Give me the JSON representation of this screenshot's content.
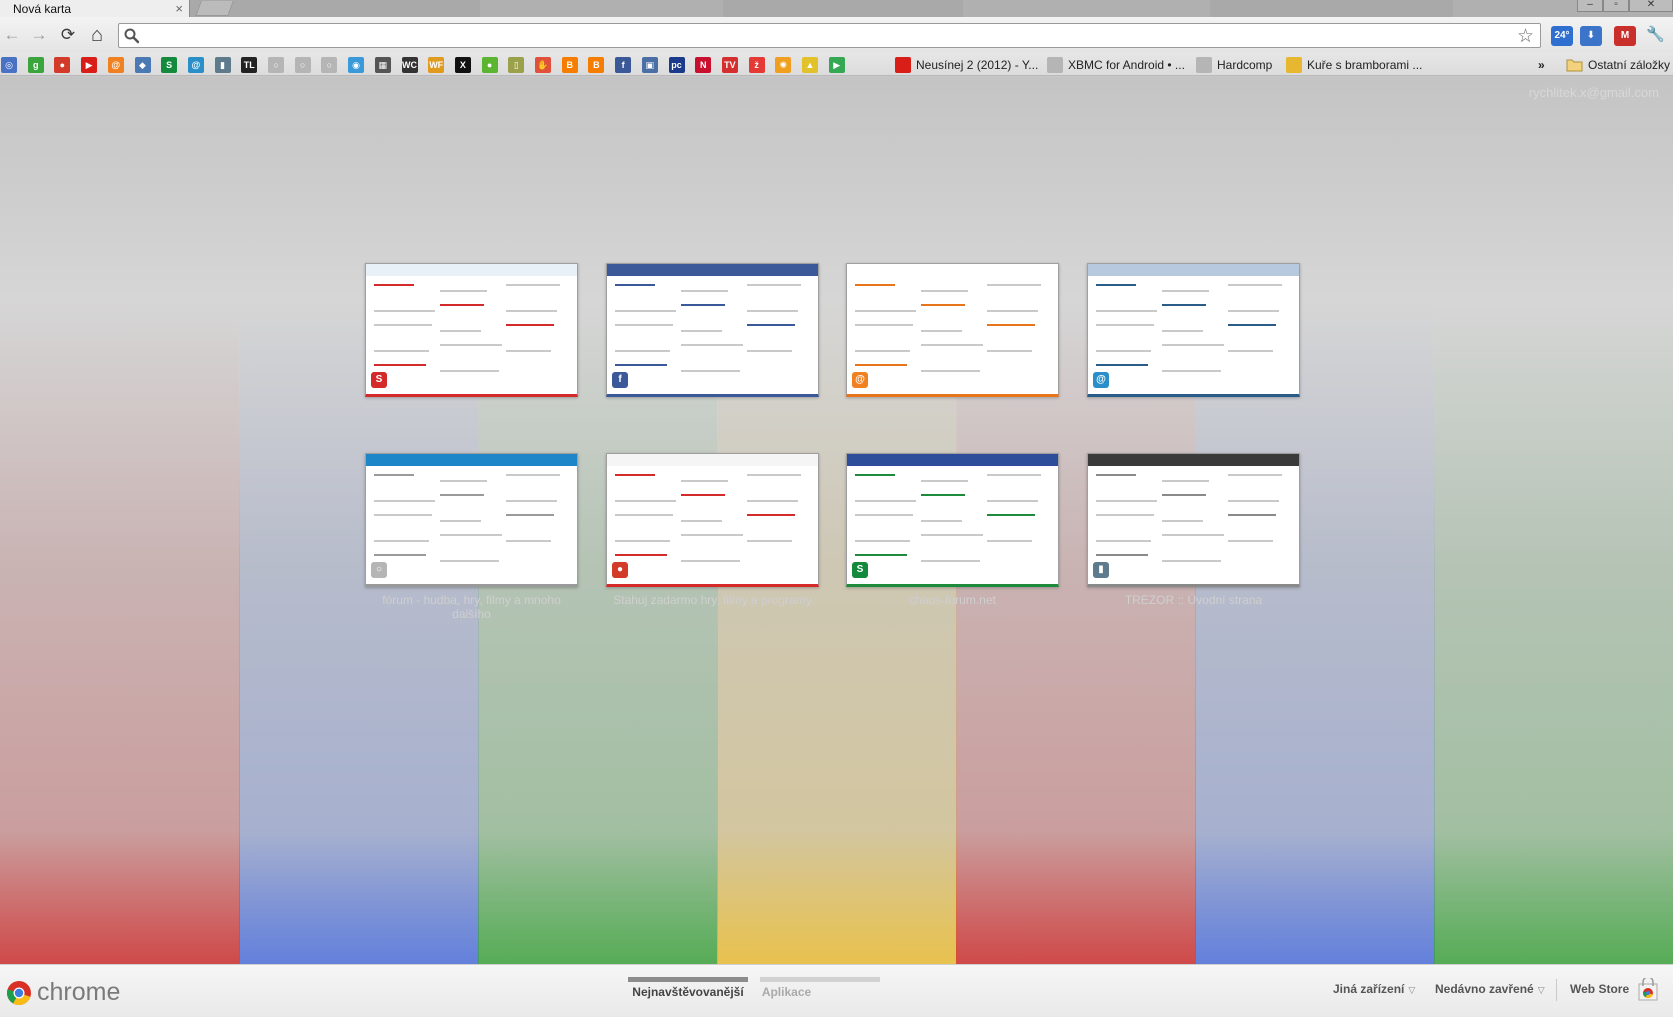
{
  "tab": {
    "title": "Nová karta",
    "close": "×"
  },
  "window_controls": {
    "minimize": "–",
    "maximize": "▫",
    "close": "✕"
  },
  "toolbar": {
    "back": "←",
    "forward": "→",
    "reload": "⟳",
    "home": "⌂",
    "omnibox_value": "",
    "star": "☆",
    "extensions": [
      {
        "name": "weather-24-extension",
        "label": "24°",
        "color": "#2f6fd0"
      },
      {
        "name": "download-extension",
        "label": "⬇",
        "color": "#3b74c9"
      },
      {
        "name": "gmail-checker-extension",
        "label": "M",
        "color": "#c9302c"
      }
    ],
    "wrench": "🔧"
  },
  "bookmarks": {
    "favicons": [
      {
        "name": "bookmark-favicon-1",
        "color": "#4a72c4",
        "glyph": "◎"
      },
      {
        "name": "bookmark-favicon-2",
        "color": "#3aa53a",
        "glyph": "g"
      },
      {
        "name": "bookmark-favicon-3",
        "color": "#d23b2a",
        "glyph": "●"
      },
      {
        "name": "bookmark-favicon-youtube",
        "color": "#d91e18",
        "glyph": "▶"
      },
      {
        "name": "bookmark-favicon-atlas",
        "color": "#f08020",
        "glyph": "@"
      },
      {
        "name": "bookmark-favicon-6",
        "color": "#4b79b4",
        "glyph": "◆"
      },
      {
        "name": "bookmark-favicon-seznam-s",
        "color": "#138a3c",
        "glyph": "S"
      },
      {
        "name": "bookmark-favicon-8",
        "color": "#2a8fc9",
        "glyph": "@"
      },
      {
        "name": "bookmark-favicon-9",
        "color": "#5d7b8c",
        "glyph": "▮"
      },
      {
        "name": "bookmark-favicon-tl",
        "color": "#222222",
        "glyph": "TL"
      },
      {
        "name": "bookmark-favicon-11",
        "color": "#b5b5b5",
        "glyph": "○"
      },
      {
        "name": "bookmark-favicon-12",
        "color": "#b5b5b5",
        "glyph": "○"
      },
      {
        "name": "bookmark-favicon-13",
        "color": "#b5b5b5",
        "glyph": "○"
      },
      {
        "name": "bookmark-favicon-14",
        "color": "#3a9ad9",
        "glyph": "◉"
      },
      {
        "name": "bookmark-favicon-15",
        "color": "#555555",
        "glyph": "▦"
      },
      {
        "name": "bookmark-favicon-wc",
        "color": "#333333",
        "glyph": "WC"
      },
      {
        "name": "bookmark-favicon-wf",
        "color": "#e09a1e",
        "glyph": "WF"
      },
      {
        "name": "bookmark-favicon-x",
        "color": "#111111",
        "glyph": "X"
      },
      {
        "name": "bookmark-favicon-xbox",
        "color": "#5cb531",
        "glyph": "●"
      },
      {
        "name": "bookmark-favicon-20",
        "color": "#9aa14a",
        "glyph": "▯"
      },
      {
        "name": "bookmark-favicon-21",
        "color": "#e0503a",
        "glyph": "✋"
      },
      {
        "name": "bookmark-favicon-blogger-1",
        "color": "#f57d00",
        "glyph": "B"
      },
      {
        "name": "bookmark-favicon-blogger-2",
        "color": "#f57d00",
        "glyph": "B"
      },
      {
        "name": "bookmark-favicon-facebook",
        "color": "#3b5998",
        "glyph": "f"
      },
      {
        "name": "bookmark-favicon-25",
        "color": "#4a6fa5",
        "glyph": "▣"
      },
      {
        "name": "bookmark-favicon-pc",
        "color": "#1b3a8c",
        "glyph": "pc"
      },
      {
        "name": "bookmark-favicon-net",
        "color": "#c8102e",
        "glyph": "N"
      },
      {
        "name": "bookmark-favicon-tv",
        "color": "#d32f2f",
        "glyph": "TV"
      },
      {
        "name": "bookmark-favicon-zive",
        "color": "#e53935",
        "glyph": "ž"
      },
      {
        "name": "bookmark-favicon-30",
        "color": "#f0a020",
        "glyph": "✺"
      },
      {
        "name": "bookmark-favicon-31",
        "color": "#e2c22a",
        "glyph": "▲"
      },
      {
        "name": "bookmark-favicon-play",
        "color": "#34a853",
        "glyph": "▶"
      }
    ],
    "items": [
      {
        "name": "bookmark-neusinej",
        "label": "Neusínej 2 (2012) - Y...",
        "color": "#d91e18"
      },
      {
        "name": "bookmark-xbmc",
        "label": "XBMC for Android • ...",
        "color": "#b5b5b5"
      },
      {
        "name": "bookmark-hardcomp",
        "label": "Hardcomp",
        "color": "#b5b5b5"
      },
      {
        "name": "bookmark-kure",
        "label": "Kuře s bramborami ...",
        "color": "#e8b730"
      }
    ],
    "overflow": "»",
    "other_bookmarks": "Ostatní záložky"
  },
  "content": {
    "user_email": "rychlitek.x@gmail.com",
    "tiles": [
      {
        "name": "tile-seznam",
        "accent": "#d42a2a",
        "header": "#e8f0f8",
        "fav_color": "#d42a2a",
        "fav_glyph": "S",
        "title": ""
      },
      {
        "name": "tile-facebook",
        "accent": "#3b5998",
        "header": "#3b5998",
        "fav_color": "#3b5998",
        "fav_glyph": "f",
        "title": ""
      },
      {
        "name": "tile-tecomat",
        "accent": "#e9751b",
        "header": "#ffffff",
        "fav_color": "#f08020",
        "fav_glyph": "@",
        "title": ""
      },
      {
        "name": "tile-dark-blue-site",
        "accent": "#2a5c8a",
        "header": "#b7c9df",
        "fav_color": "#2a8fc9",
        "fav_glyph": "@",
        "title": ""
      },
      {
        "name": "tile-forum-blue",
        "accent": "#9a9a9a",
        "header": "#1d86c9",
        "fav_color": "#b5b5b5",
        "fav_glyph": "○",
        "title": "fórum - hudba, hry, filmy a mnoho dalšího"
      },
      {
        "name": "tile-apple-site",
        "accent": "#d42a2a",
        "header": "#f5f5f5",
        "fav_color": "#d23b2a",
        "fav_glyph": "●",
        "title": "Stahuj zadarmo hry, filmy a programy"
      },
      {
        "name": "tile-sk-forum",
        "accent": "#1e8a3c",
        "header": "#2d4c9a",
        "fav_color": "#138a3c",
        "fav_glyph": "S",
        "title": "chaos-forum.net"
      },
      {
        "name": "tile-trezor",
        "accent": "#8a8a8a",
        "header": "#3a3a3a",
        "fav_color": "#5d7b8c",
        "fav_glyph": "▮",
        "title": "TREZOR :: Úvodní strana"
      }
    ]
  },
  "footer": {
    "logo_word": "chrome",
    "sections": [
      {
        "name": "section-most-visited",
        "label": "Nejnavštěvovanější",
        "active": true
      },
      {
        "name": "section-apps",
        "label": "Aplikace",
        "active": false
      }
    ],
    "other_devices": "Jiná zařízení",
    "recently_closed": "Nedávno zavřené",
    "caret": "▽",
    "web_store": "Web Store"
  },
  "colors": {
    "bands": [
      "#d12a2a",
      "#4a6ee0",
      "#3aa53a",
      "#f0c030",
      "#d12a2a",
      "#4a6ee0",
      "#3aa53a"
    ]
  }
}
